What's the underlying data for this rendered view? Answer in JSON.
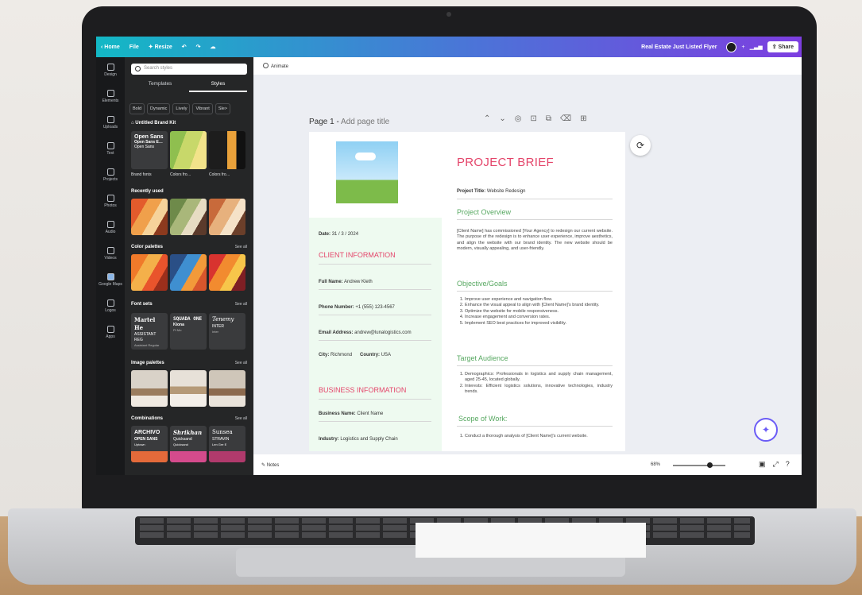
{
  "topbar": {
    "home": "‹ Home",
    "file": "File",
    "resize": "✦ Resize",
    "doc_title": "Real Estate Just Listed Flyer",
    "share": "Share"
  },
  "rail": [
    "Design",
    "Elements",
    "Uploads",
    "Text",
    "Projects",
    "Photos",
    "Audio",
    "Videos",
    "Google Maps",
    "Logos",
    "Apps"
  ],
  "panel": {
    "search_placeholder": "Search styles",
    "tabs": [
      "Templates",
      "Styles"
    ],
    "chips": [
      "Bold",
      "Dynamic",
      "Lively",
      "Vibrant",
      "Sle>"
    ],
    "brand_kit": "Untitled Brand Kit",
    "brand_fonts_card": [
      "Open Sans",
      "Open Sans E…",
      "Open Sans"
    ],
    "brand_labels": [
      "Brand fonts",
      "Colors fro…",
      "Colors fro…"
    ],
    "recently_used": "Recently used",
    "color_palettes": "Color palettes",
    "font_sets": "Font sets",
    "image_palettes": "Image palettes",
    "combinations": "Combinations",
    "see_all": "See all",
    "font_sets_cards": [
      {
        "a": "Martel He",
        "b": "ASSISTANT REG",
        "c": "Assistant Regular"
      },
      {
        "a": "SQUADA ONE",
        "b": "Kiona",
        "c": "Pt Mo"
      },
      {
        "a": "Tenemy",
        "b": "INTER",
        "c": "Inter"
      }
    ],
    "combo_cards": [
      {
        "a": "ARCHIVO",
        "b": "OPEN SANS",
        "c": "Uptown"
      },
      {
        "a": "Shrikhan",
        "b": "Quicksand",
        "c": "Quicksand"
      },
      {
        "a": "Sunsea",
        "b": "STRAVIN",
        "c": "Len Gre E"
      }
    ]
  },
  "canvas": {
    "animate": "Animate",
    "page_label": "Page 1 -",
    "page_title_placeholder": "Add page title"
  },
  "doc": {
    "title": "PROJECT BRIEF",
    "project_title_label": "Project Title:",
    "project_title_value": "Website Redesign",
    "date_label": "Date:",
    "date_value": "31 / 3 / 2024",
    "client_info": "CLIENT INFORMATION",
    "full_name_label": "Full Name:",
    "full_name_value": "Andrew Kleth",
    "phone_label": "Phone Number:",
    "phone_value": "+1 (555) 123-4567",
    "email_label": "Email Address:",
    "email_value": "andrew@lunalogistics.com",
    "city_label": "City:",
    "city_value": "Richmond",
    "country_label": "Country:",
    "country_value": "USA",
    "business_info": "BUSINESS INFORMATION",
    "business_name_label": "Business Name:",
    "business_name_value": "Client Name",
    "industry_label": "Industry:",
    "industry_value": "Logistics and Supply Chain",
    "overview_h": "Project Overview",
    "overview_text": "[Client Name] has commissioned [Your Agency] to redesign our current website. The purpose of the redesign is to enhance user experience, improve aesthetics, and align the website with our brand identity. The new website should be modern, visually appealing, and user-friendly.",
    "objectives_h": "Objective/Goals",
    "objectives": [
      "Improve user experience and navigation flow.",
      "Enhance the visual appeal to align with [Client Name]'s brand identity.",
      "Optimize the website for mobile responsiveness.",
      "Increase engagement and conversion rates.",
      "Implement SEO best practices for improved visibility."
    ],
    "audience_h": "Target Audience",
    "audience": [
      "Demographics: Professionals in logistics and supply chain management, aged 25-45, located globally.",
      "Interests: Efficient logistics solutions, innovative technologies, industry trends."
    ],
    "scope_h": "Scope of Work:",
    "scope": [
      "Conduct a thorough analysis of [Client Name]'s current website."
    ]
  },
  "bottombar": {
    "notes": "Notes",
    "zoom": "68%",
    "zoom_level": 0.7
  },
  "colors": {
    "accent_pink": "#e4456a",
    "accent_green": "#57a861",
    "topbar_start": "#13b8c5",
    "topbar_end": "#7d3ee0"
  }
}
